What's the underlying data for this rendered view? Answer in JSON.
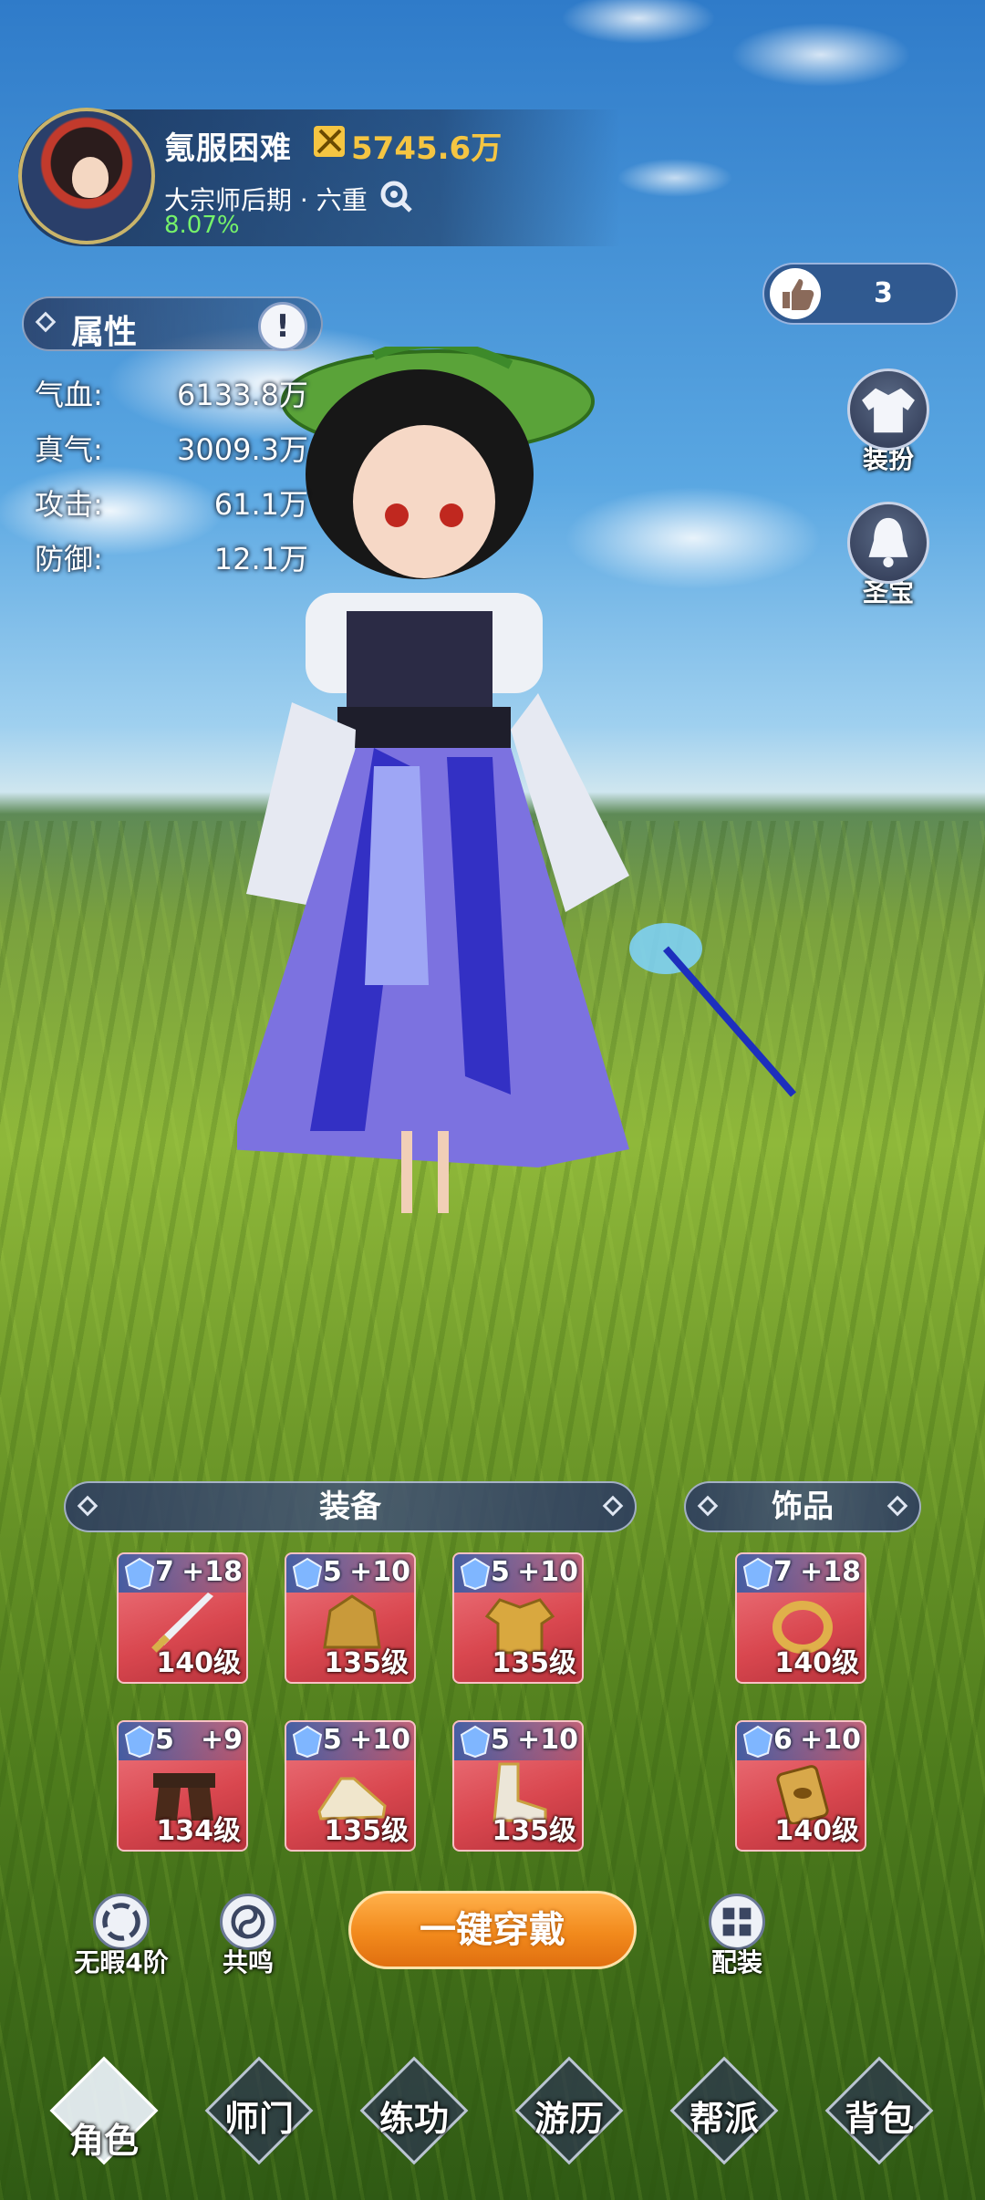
{
  "player": {
    "name": "氪服困难",
    "power": "5745.6万",
    "realm": "大宗师后期 · 六重",
    "exp_percent": "8.07%"
  },
  "likes": {
    "count": "3"
  },
  "side_buttons": [
    {
      "label": "装扮",
      "icon": "outfit-icon"
    },
    {
      "label": "圣宝",
      "icon": "bell-icon"
    }
  ],
  "attributes": {
    "title": "属性",
    "info_label": "!",
    "rows": [
      {
        "label": "气血:",
        "value": "6133.8万"
      },
      {
        "label": "真气:",
        "value": "3009.3万"
      },
      {
        "label": "攻击:",
        "value": "61.1万"
      },
      {
        "label": "防御:",
        "value": "12.1万"
      }
    ]
  },
  "equipment": {
    "title": "装备",
    "slots": [
      {
        "tier": "7",
        "enhance": "+18",
        "level": "140级",
        "icon": "sword-icon"
      },
      {
        "tier": "5",
        "enhance": "+10",
        "level": "135级",
        "icon": "helmet-icon"
      },
      {
        "tier": "5",
        "enhance": "+10",
        "level": "135级",
        "icon": "armor-icon"
      },
      {
        "tier": "5",
        "enhance": "+9",
        "level": "134级",
        "icon": "belt-icon"
      },
      {
        "tier": "5",
        "enhance": "+10",
        "level": "135级",
        "icon": "shoe-icon"
      },
      {
        "tier": "5",
        "enhance": "+10",
        "level": "135级",
        "icon": "boots-icon"
      }
    ]
  },
  "accessories": {
    "title": "饰品",
    "slots": [
      {
        "tier": "7",
        "enhance": "+18",
        "level": "140级",
        "icon": "ring-icon"
      },
      {
        "tier": "6",
        "enhance": "+10",
        "level": "140级",
        "icon": "amulet-icon"
      }
    ]
  },
  "actions": {
    "flawless": "无暇4阶",
    "resonance": "共鸣",
    "equip_all": "一键穿戴",
    "loadout": "配装"
  },
  "nav": [
    {
      "label": "角色",
      "active": true
    },
    {
      "label": "师门"
    },
    {
      "label": "练功"
    },
    {
      "label": "游历"
    },
    {
      "label": "帮派"
    },
    {
      "label": "背包"
    }
  ],
  "colors": {
    "power": "#f5c542",
    "exp": "#76f26a",
    "slot_bg": "#d9474f",
    "equip_all_button": "#f28a1c"
  }
}
